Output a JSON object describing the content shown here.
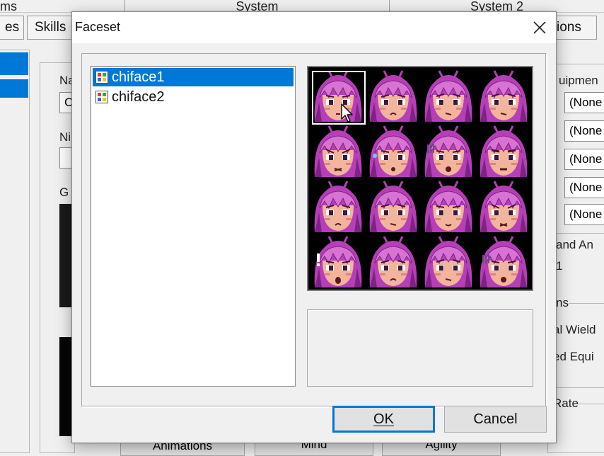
{
  "background": {
    "top_tabs": [
      "ms",
      "System",
      "System 2"
    ],
    "second_tabs": [
      "es",
      "Skills",
      "ions"
    ],
    "labels": {
      "na": "Na",
      "c": "C",
      "ni": "Ni",
      "g": "G",
      "equipment": "uipmen",
      "battle_anim": "and An",
      "one": "1",
      "options": "ns",
      "dual_wield": "al Wield",
      "locked_equip": "ed Equi",
      "crit_rate": "Rate"
    },
    "equip_slots": [
      "(None",
      "(None",
      "(None",
      "(None",
      "(None"
    ],
    "bottom_buttons": [
      "Animations",
      "Mind",
      "Agility"
    ]
  },
  "dialog": {
    "title": "Faceset",
    "close_icon": "close-icon",
    "files": [
      {
        "name": "chiface1",
        "selected": true
      },
      {
        "name": "chiface2",
        "selected": false
      }
    ],
    "ok_label": "OK",
    "cancel_label": "Cancel",
    "selected_face_index": 0
  },
  "faces": [
    {
      "expr": "neutral"
    },
    {
      "expr": "sad"
    },
    {
      "expr": "worried"
    },
    {
      "expr": "worried"
    },
    {
      "expr": "angry"
    },
    {
      "expr": "sweat"
    },
    {
      "expr": "shock"
    },
    {
      "expr": "annoyed"
    },
    {
      "expr": "sad"
    },
    {
      "expr": "worried"
    },
    {
      "expr": "tired"
    },
    {
      "expr": "angry"
    },
    {
      "expr": "surprise"
    },
    {
      "expr": "sad"
    },
    {
      "expr": "worried"
    },
    {
      "expr": "shock"
    }
  ],
  "colors": {
    "hair": "#b63fb8",
    "hair_dark": "#7e2385",
    "hair_light": "#d873d4",
    "skin": "#f2b49c",
    "skin_shade": "#d9877a",
    "selection": "#0078d7"
  }
}
